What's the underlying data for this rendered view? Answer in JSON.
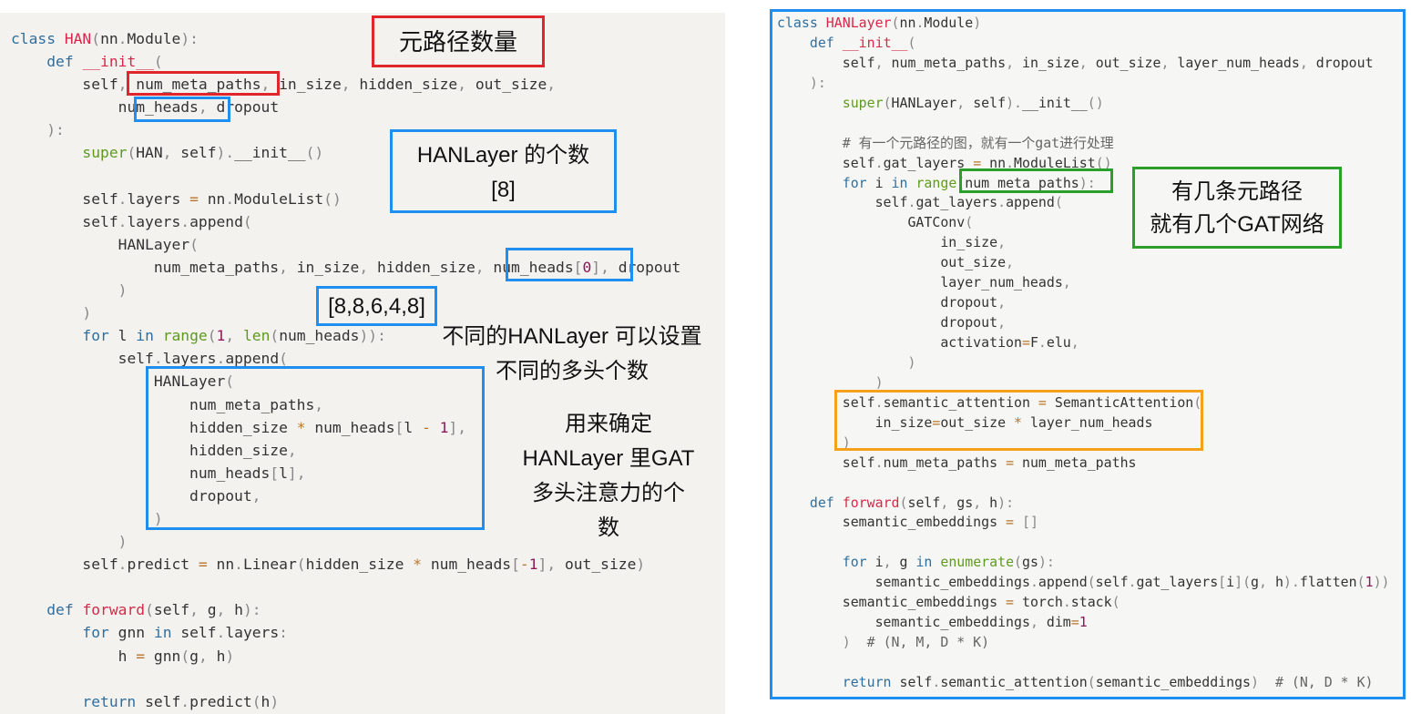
{
  "left_code": [
    "class HAN(nn.Module):",
    "    def __init__(",
    "        self, num_meta_paths, in_size, hidden_size, out_size,",
    "            num_heads, dropout",
    "    ):",
    "        super(HAN, self).__init__()",
    "",
    "        self.layers = nn.ModuleList()",
    "        self.layers.append(",
    "            HANLayer(",
    "                num_meta_paths, in_size, hidden_size, num_heads[0], dropout",
    "            )",
    "        )",
    "        for l in range(1, len(num_heads)):",
    "            self.layers.append(",
    "                HANLayer(",
    "                    num_meta_paths,",
    "                    hidden_size * num_heads[l - 1],",
    "                    hidden_size,",
    "                    num_heads[l],",
    "                    dropout,",
    "                )",
    "            )",
    "        self.predict = nn.Linear(hidden_size * num_heads[-1], out_size)",
    "",
    "    def forward(self, g, h):",
    "        for gnn in self.layers:",
    "            h = gnn(g, h)",
    "",
    "        return self.predict(h)"
  ],
  "right_code": [
    "class HANLayer(nn.Module)",
    "    def __init__(",
    "        self, num_meta_paths, in_size, out_size, layer_num_heads, dropout",
    "    ):",
    "        super(HANLayer, self).__init__()",
    "",
    "        # 有一个元路径的图，就有一个gat进行处理",
    "        self.gat_layers = nn.ModuleList()",
    "        for i in range(num_meta_paths):",
    "            self.gat_layers.append(",
    "                GATConv(",
    "                    in_size,",
    "                    out_size,",
    "                    layer_num_heads,",
    "                    dropout,",
    "                    dropout,",
    "                    activation=F.elu,",
    "                )",
    "            )",
    "        self.semantic_attention = SemanticAttention(",
    "            in_size=out_size * layer_num_heads",
    "        )",
    "        self.num_meta_paths = num_meta_paths",
    "",
    "    def forward(self, gs, h):",
    "        semantic_embeddings = []",
    "",
    "        for i, g in enumerate(gs):",
    "            semantic_embeddings.append(self.gat_layers[i](g, h).flatten(1))",
    "        semantic_embeddings = torch.stack(",
    "            semantic_embeddings, dim=1",
    "        )  # (N, M, D * K)",
    "",
    "        return self.semantic_attention(semantic_embeddings)  # (N, D * K)"
  ],
  "annotations": {
    "meta_path_count": "元路径数量",
    "hanlayer_count_l1": "HANLayer 的个数",
    "hanlayer_count_l2": "[8]",
    "heads_list": "[8,8,6,4,8]",
    "diff_heads_l1": "不同的HANLayer 可以设置",
    "diff_heads_l2": "不同的多头个数",
    "gat_heads_l1": "用来确定",
    "gat_heads_l2": "HANLayer 里GAT",
    "gat_heads_l3": "多头注意力的个",
    "gat_heads_l4": "数",
    "gat_per_path_l1": "有几条元路径",
    "gat_per_path_l2": "就有几个GAT网络"
  },
  "colors": {
    "red": "#e0262a",
    "blue": "#1e8ff0",
    "green": "#2aa02a",
    "orange": "#f5a11c"
  }
}
